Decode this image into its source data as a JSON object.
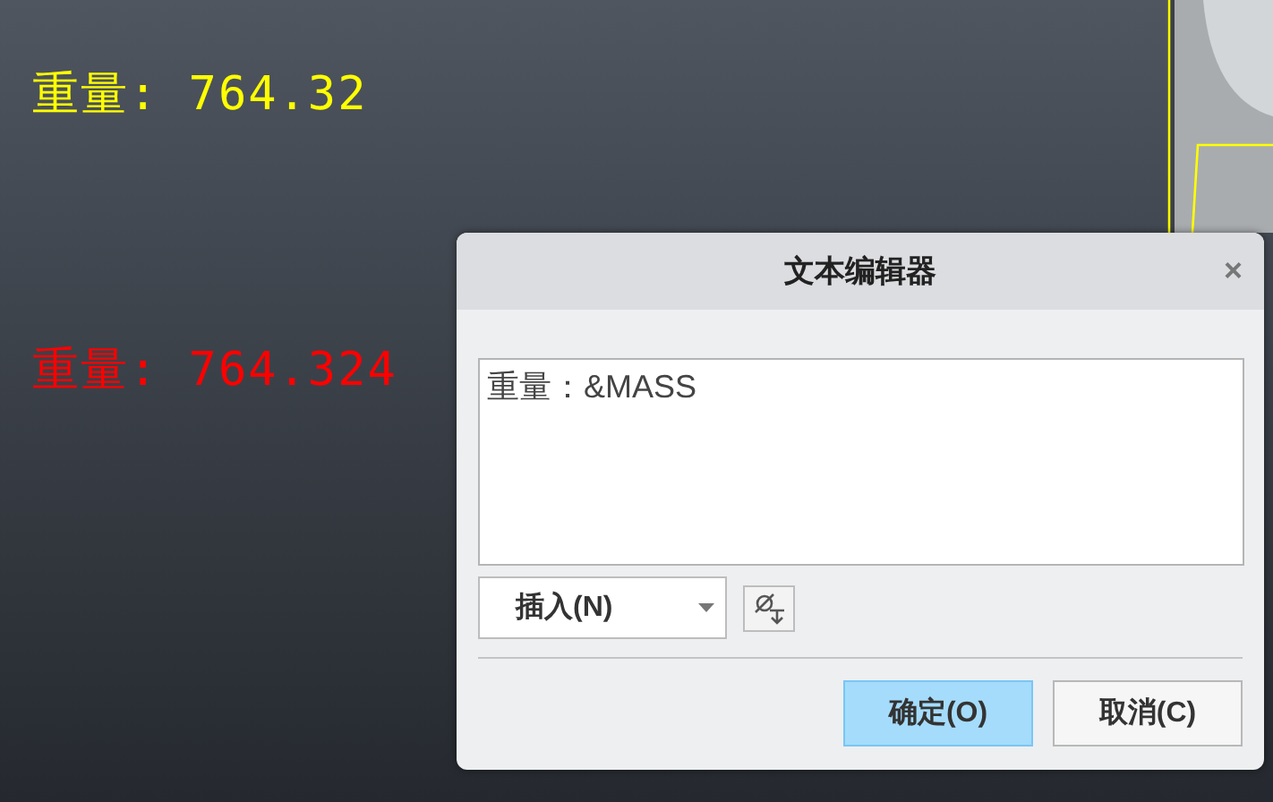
{
  "canvas": {
    "notes": [
      {
        "text": "重量: 764.32",
        "color": "#ffff00"
      },
      {
        "text": "重量: 764.324",
        "color": "#ff0000"
      }
    ]
  },
  "dialog": {
    "title": "文本编辑器",
    "close": "×",
    "editor": {
      "value": "重量：&MASS"
    },
    "insert": {
      "label": "插入(N)"
    },
    "buttons": [
      {
        "label": "确定(O)",
        "default": true
      },
      {
        "label": "取消(C)",
        "default": false
      }
    ]
  }
}
